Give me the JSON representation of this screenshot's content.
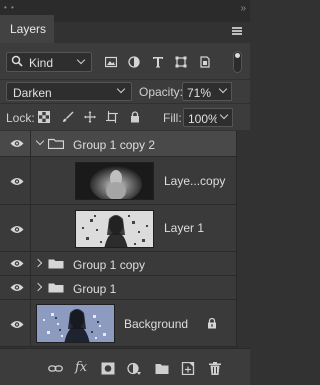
{
  "panel": {
    "tab_label": "Layers"
  },
  "filter": {
    "kind_label": "Kind",
    "icons": [
      "image-filter-icon",
      "adjustment-filter-icon",
      "type-filter-icon",
      "shape-filter-icon",
      "smart-object-filter-icon"
    ]
  },
  "blend": {
    "mode": "Darken",
    "opacity_label": "Opacity:",
    "opacity_value": "71%"
  },
  "lock": {
    "label": "Lock:",
    "fill_label": "Fill:",
    "fill_value": "100%"
  },
  "layers": [
    {
      "name": "Group 1 copy 2",
      "type": "group",
      "expanded": true,
      "selected": true
    },
    {
      "name": "Laye...copy",
      "type": "layer"
    },
    {
      "name": "Layer 1",
      "type": "layer"
    },
    {
      "name": "Group 1 copy",
      "type": "group",
      "expanded": false
    },
    {
      "name": "Group 1",
      "type": "group",
      "expanded": false
    },
    {
      "name": "Background",
      "type": "background",
      "locked": true
    }
  ],
  "bottom_bar": {
    "fx_label": "fx"
  },
  "colors": {
    "panel_bg": "#323232",
    "row_bg": "#3a3a3a",
    "selected_row_bg": "#494949",
    "text": "#dedede"
  }
}
